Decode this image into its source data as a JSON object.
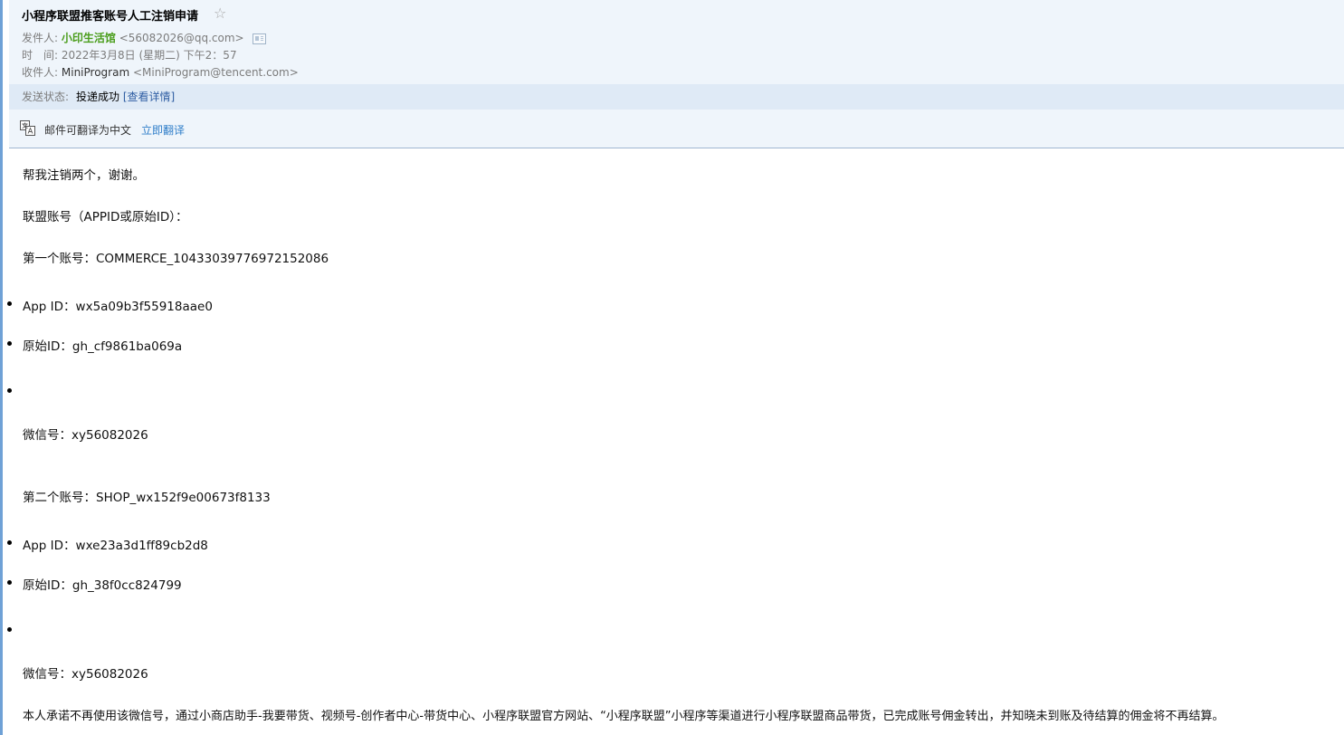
{
  "email": {
    "subject": "小程序联盟推客账号人工注销申请",
    "star_icon": "☆",
    "from_label": "发件人:",
    "from_name": "小印生活馆",
    "from_addr": "<56082026@qq.com>",
    "time_label": "时　间:",
    "time_value": "2022年3月8日 (星期二) 下午2：57",
    "to_label": "收件人:",
    "to_name": "MiniProgram",
    "to_addr": "<MiniProgram@tencent.com>"
  },
  "status": {
    "label": "发送状态:",
    "value": "投递成功",
    "details_link": "[查看详情]"
  },
  "translate": {
    "icon": "translate-icon",
    "label": "邮件可翻译为中文",
    "link": "立即翻译"
  },
  "body": {
    "line1": "帮我注销两个，谢谢。",
    "line2": "联盟账号（APPID或原始ID）：",
    "account1": "第一个账号：COMMERCE_10433039776972152086",
    "account1_appid": "App ID：wx5a09b3f55918aae0",
    "account1_origid": "原始ID：gh_cf9861ba069a",
    "account1_wechat": "微信号：xy56082026",
    "account2": "第二个账号：SHOP_wx152f9e00673f8133",
    "account2_appid": "App ID：wxe23a3d1ff89cb2d8",
    "account2_origid": "原始ID：gh_38f0cc824799",
    "account2_wechat": "微信号：xy56082026",
    "commitment": "本人承诺不再使用该微信号，通过小商店助手-我要带货、视频号-创作者中心-带货中心、小程序联盟官方网站、“小程序联盟”小程序等渠道进行小程序联盟商品带货，已完成账号佣金转出，并知晓未到账及待结算的佣金将不再结算。"
  },
  "colors": {
    "header_bg": "#eff5fb",
    "status_bg": "#dfeaf6",
    "sender_green": "#4a9d1b",
    "link_blue": "#2f7ec9"
  }
}
